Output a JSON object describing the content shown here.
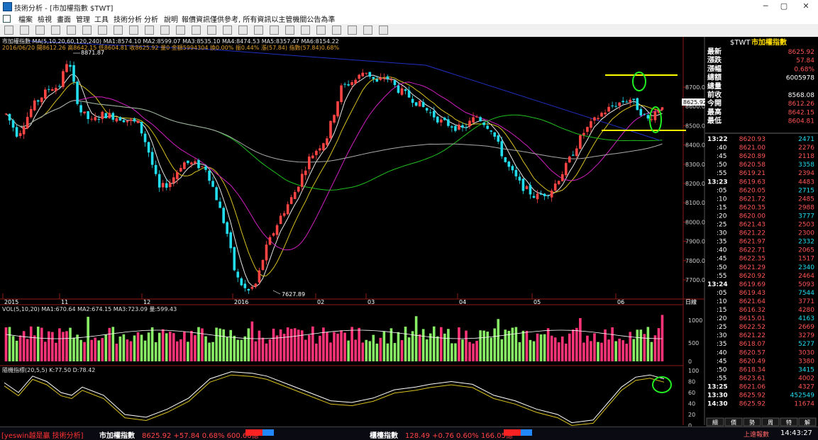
{
  "window": {
    "title": "技術分析 - [市加權指數 $TWT]",
    "controls": [
      "─",
      "▢",
      "✕"
    ]
  },
  "menu": [
    "檔案",
    "檢視",
    "畫面",
    "管理",
    "工具",
    "技術分析",
    "分析",
    "說明",
    "報價資訊僅供參考, 所有資訊以主管機關公告為準"
  ],
  "toolbar": {
    "icons": [
      "back-icon",
      "zoom-in-icon",
      "zoom-out-icon",
      "period-icon",
      "grid-icon",
      "chart-icon",
      "chart2-icon",
      "layout-icon",
      "layout2-icon",
      "layout3-icon",
      "cursor-icon",
      "draw-icon",
      "line-icon",
      "bars-icon",
      "trend-icon",
      "fib-icon",
      "pen-icon",
      "rect-icon",
      "ellipse-icon",
      "text-icon",
      "copy-icon",
      "paste-icon",
      "delete-icon",
      "list-icon",
      "save-icon"
    ]
  },
  "chart": {
    "price_header1": "市加權指數 MA(5,10,20,60,120,240) MA1:8574.10 MA2:8599.07 MA3:8535.10 MA4:8474.53 MA5:8357.47 MA6:8154.22",
    "price_header2": "2016/06/20 開8612.26 高8642.15 低8604.81 收8625.92 量0 金額5994304 換0.00% 振0.44% 漲(57.84) 指數(57.84)0.68%",
    "high_label": "8871.87",
    "low_label": "7627.89",
    "last_label": "8625.92",
    "period_label": "日線",
    "y_ticks": [
      "8700.0",
      "8600.0",
      "8500.0",
      "8400.0",
      "8300.0",
      "8200.0",
      "8100.0",
      "8000.0",
      "7900.0",
      "7800.0",
      "7700.0"
    ],
    "x_ticks": [
      "2015",
      "11",
      "12",
      "2016",
      "02",
      "03",
      "04",
      "05",
      "06"
    ],
    "volume_header": "VOL(5,10,20) MA1:670.64 MA2:674.15 MA3:723.09 量:599.43",
    "volume_ticks": [
      "1000",
      "500",
      "0"
    ],
    "kd_header": "隨機指標(20,5,5) K:77.50 D:78.42",
    "kd_ticks": [
      "100",
      "80",
      "60",
      "40",
      "20",
      "0"
    ],
    "colors": {
      "up": "#ff4444",
      "down": "#22ddee",
      "vol_up": "#ff3377",
      "vol_down": "#88ee66",
      "highlight": "#ffff00",
      "circle": "#22ee22"
    }
  },
  "quote": {
    "title_code": "$TWT",
    "title_name": "市加權指數",
    "rows": [
      {
        "label": "最新",
        "value": "8625.92"
      },
      {
        "label": "漲跌",
        "value": "57.84"
      },
      {
        "label": "漲幅",
        "value": "0.68%"
      },
      {
        "label": "總額",
        "value": "6005978"
      },
      {
        "label": "總量",
        "value": ""
      },
      {
        "label": "前收",
        "value": "8568.08"
      },
      {
        "label": "今開",
        "value": "8612.26"
      },
      {
        "label": "最高",
        "value": "8642.15"
      },
      {
        "label": "最低",
        "value": "8604.81"
      }
    ],
    "ticks": [
      {
        "time": "13:22",
        "price": "8620.93",
        "vol": "2471"
      },
      {
        "time": ":40",
        "price": "8621.00",
        "vol": "2276"
      },
      {
        "time": ":45",
        "price": "8620.89",
        "vol": "2118"
      },
      {
        "time": ":50",
        "price": "8620.58",
        "vol": "3358"
      },
      {
        "time": ":55",
        "price": "8619.21",
        "vol": "2394"
      },
      {
        "time": "13:23",
        "price": "8619.63",
        "vol": "4483"
      },
      {
        "time": ":05",
        "price": "8620.05",
        "vol": "2715"
      },
      {
        "time": ":10",
        "price": "8621.72",
        "vol": "2485"
      },
      {
        "time": ":15",
        "price": "8620.35",
        "vol": "2988"
      },
      {
        "time": ":20",
        "price": "8620.00",
        "vol": "3777"
      },
      {
        "time": ":25",
        "price": "8621.43",
        "vol": "2503"
      },
      {
        "time": ":30",
        "price": "8621.22",
        "vol": "2300"
      },
      {
        "time": ":35",
        "price": "8621.97",
        "vol": "2332"
      },
      {
        "time": ":40",
        "price": "8622.71",
        "vol": "2065"
      },
      {
        "time": ":45",
        "price": "8622.35",
        "vol": "1517"
      },
      {
        "time": ":50",
        "price": "8621.29",
        "vol": "2340"
      },
      {
        "time": ":55",
        "price": "8620.92",
        "vol": "2464"
      },
      {
        "time": "13:24",
        "price": "8619.69",
        "vol": "5093"
      },
      {
        "time": ":05",
        "price": "8619.43",
        "vol": "7544"
      },
      {
        "time": ":10",
        "price": "8621.64",
        "vol": "3771"
      },
      {
        "time": ":15",
        "price": "8616.32",
        "vol": "4280"
      },
      {
        "time": ":20",
        "price": "8615.01",
        "vol": "4163"
      },
      {
        "time": ":25",
        "price": "8622.52",
        "vol": "2669"
      },
      {
        "time": ":30",
        "price": "8621.22",
        "vol": "3279"
      },
      {
        "time": ":35",
        "price": "8618.07",
        "vol": "5277"
      },
      {
        "time": ":40",
        "price": "8620.57",
        "vol": "3030"
      },
      {
        "time": ":45",
        "price": "8620.49",
        "vol": "3380"
      },
      {
        "time": ":50",
        "price": "8618.34",
        "vol": "3415"
      },
      {
        "time": ":55",
        "price": "8623.61",
        "vol": "4002"
      },
      {
        "time": "13:25",
        "price": "8621.06",
        "vol": "4327"
      },
      {
        "time": "13:30",
        "price": "8625.92",
        "vol": "452549"
      },
      {
        "time": "14:30",
        "price": "8625.92",
        "vol": "11674"
      }
    ],
    "tabs": [
      "細",
      "價",
      "勢",
      "周",
      "特",
      "解"
    ]
  },
  "status": {
    "brand": "[yeswin越是贏 技術分析]",
    "idx1_name": "市加權指數",
    "idx1_val": "8625.92 +57.84 0.68% 600.60億",
    "idx2_name": "櫃檯指數",
    "idx2_val": "128.49 +0.76 0.60% 166.05億",
    "connection": "上遠報數",
    "time": "14:43:27"
  }
}
